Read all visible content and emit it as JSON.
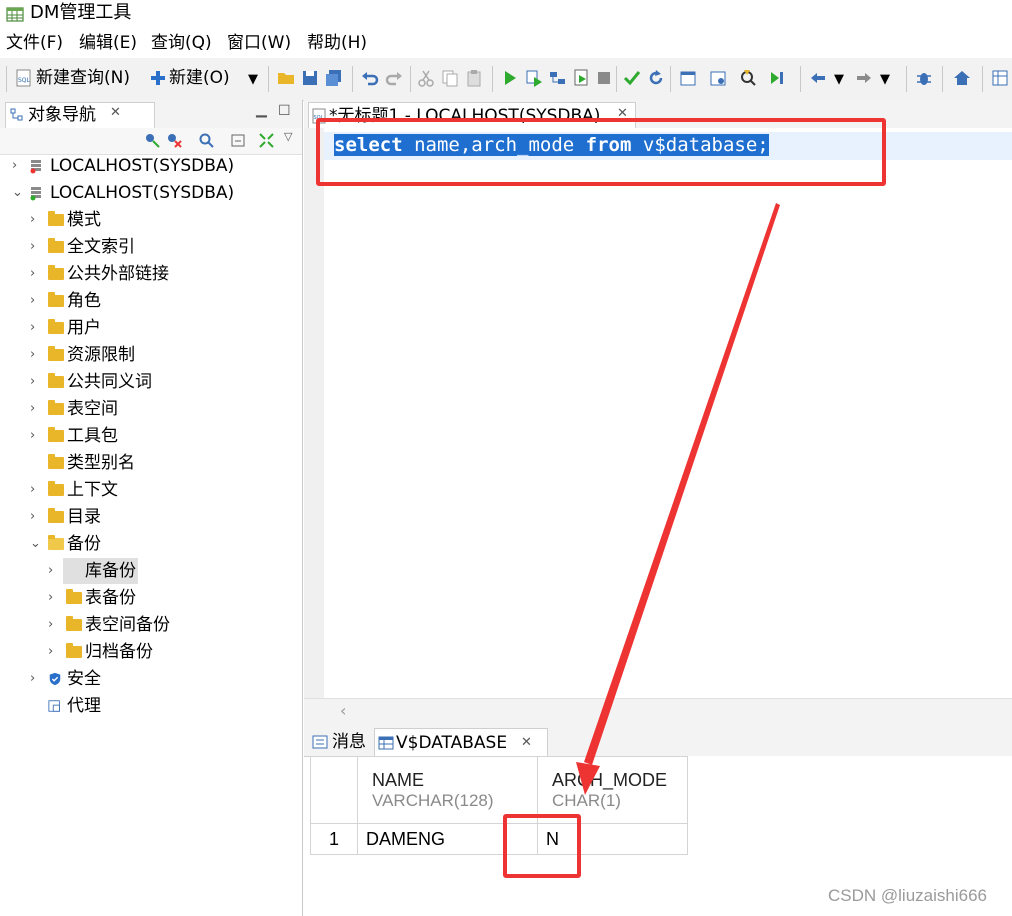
{
  "window": {
    "title": "DM管理工具"
  },
  "menu": [
    "文件(F)",
    "编辑(E)",
    "查询(Q)",
    "窗口(W)",
    "帮助(H)"
  ],
  "toolbar": {
    "new_query_label": "新建查询(N)",
    "new_label": "新建(O)"
  },
  "navigator": {
    "tab_label": "对象导航",
    "tree": [
      {
        "label": "LOCALHOST(SYSDBA)",
        "level": 0,
        "expanded": false,
        "icon": "db-disconnected-icon"
      },
      {
        "label": "LOCALHOST(SYSDBA)",
        "level": 0,
        "expanded": true,
        "icon": "db-connected-icon"
      },
      {
        "label": "模式",
        "level": 1,
        "expanded": false,
        "icon": "folder-icon"
      },
      {
        "label": "全文索引",
        "level": 1,
        "expanded": false,
        "icon": "folder-icon"
      },
      {
        "label": "公共外部链接",
        "level": 1,
        "expanded": false,
        "icon": "folder-icon"
      },
      {
        "label": "角色",
        "level": 1,
        "expanded": false,
        "icon": "folder-icon"
      },
      {
        "label": "用户",
        "level": 1,
        "expanded": false,
        "icon": "folder-icon"
      },
      {
        "label": "资源限制",
        "level": 1,
        "expanded": false,
        "icon": "folder-icon"
      },
      {
        "label": "公共同义词",
        "level": 1,
        "expanded": false,
        "icon": "folder-icon"
      },
      {
        "label": "表空间",
        "level": 1,
        "expanded": false,
        "icon": "folder-icon"
      },
      {
        "label": "工具包",
        "level": 1,
        "expanded": false,
        "icon": "folder-icon"
      },
      {
        "label": "类型别名",
        "level": 1,
        "expanded": null,
        "icon": "folder-icon"
      },
      {
        "label": "上下文",
        "level": 1,
        "expanded": false,
        "icon": "folder-icon"
      },
      {
        "label": "目录",
        "level": 1,
        "expanded": false,
        "icon": "folder-icon"
      },
      {
        "label": "备份",
        "level": 1,
        "expanded": true,
        "icon": "folder-open-icon"
      },
      {
        "label": "库备份",
        "level": 2,
        "expanded": false,
        "icon": "folder-icon",
        "selected": true
      },
      {
        "label": "表备份",
        "level": 2,
        "expanded": false,
        "icon": "folder-icon"
      },
      {
        "label": "表空间备份",
        "level": 2,
        "expanded": false,
        "icon": "folder-icon"
      },
      {
        "label": "归档备份",
        "level": 2,
        "expanded": false,
        "icon": "folder-icon"
      },
      {
        "label": "安全",
        "level": 1,
        "expanded": false,
        "icon": "shield-icon"
      },
      {
        "label": "代理",
        "level": 1,
        "expanded": null,
        "icon": "agent-icon"
      }
    ]
  },
  "editor": {
    "tab_label": "*无标题1 - LOCALHOST(SYSDBA)",
    "sql": {
      "kw1": "select",
      "part2": " name,arch_mode ",
      "kw2": "from",
      "part4": " v$database;"
    }
  },
  "results": {
    "tabs": [
      "消息",
      "V$DATABASE"
    ],
    "columns": [
      {
        "name": "NAME",
        "type": "VARCHAR(128)"
      },
      {
        "name": "ARCH_MODE",
        "type": "CHAR(1)"
      }
    ],
    "rows": [
      {
        "index": "1",
        "cells": [
          "DAMENG",
          "N"
        ]
      }
    ]
  },
  "watermark": "CSDN @liuzaishi666",
  "colors": {
    "annotation": "#e33333",
    "selection": "#1f6fd1",
    "folder": "#e8b628"
  }
}
